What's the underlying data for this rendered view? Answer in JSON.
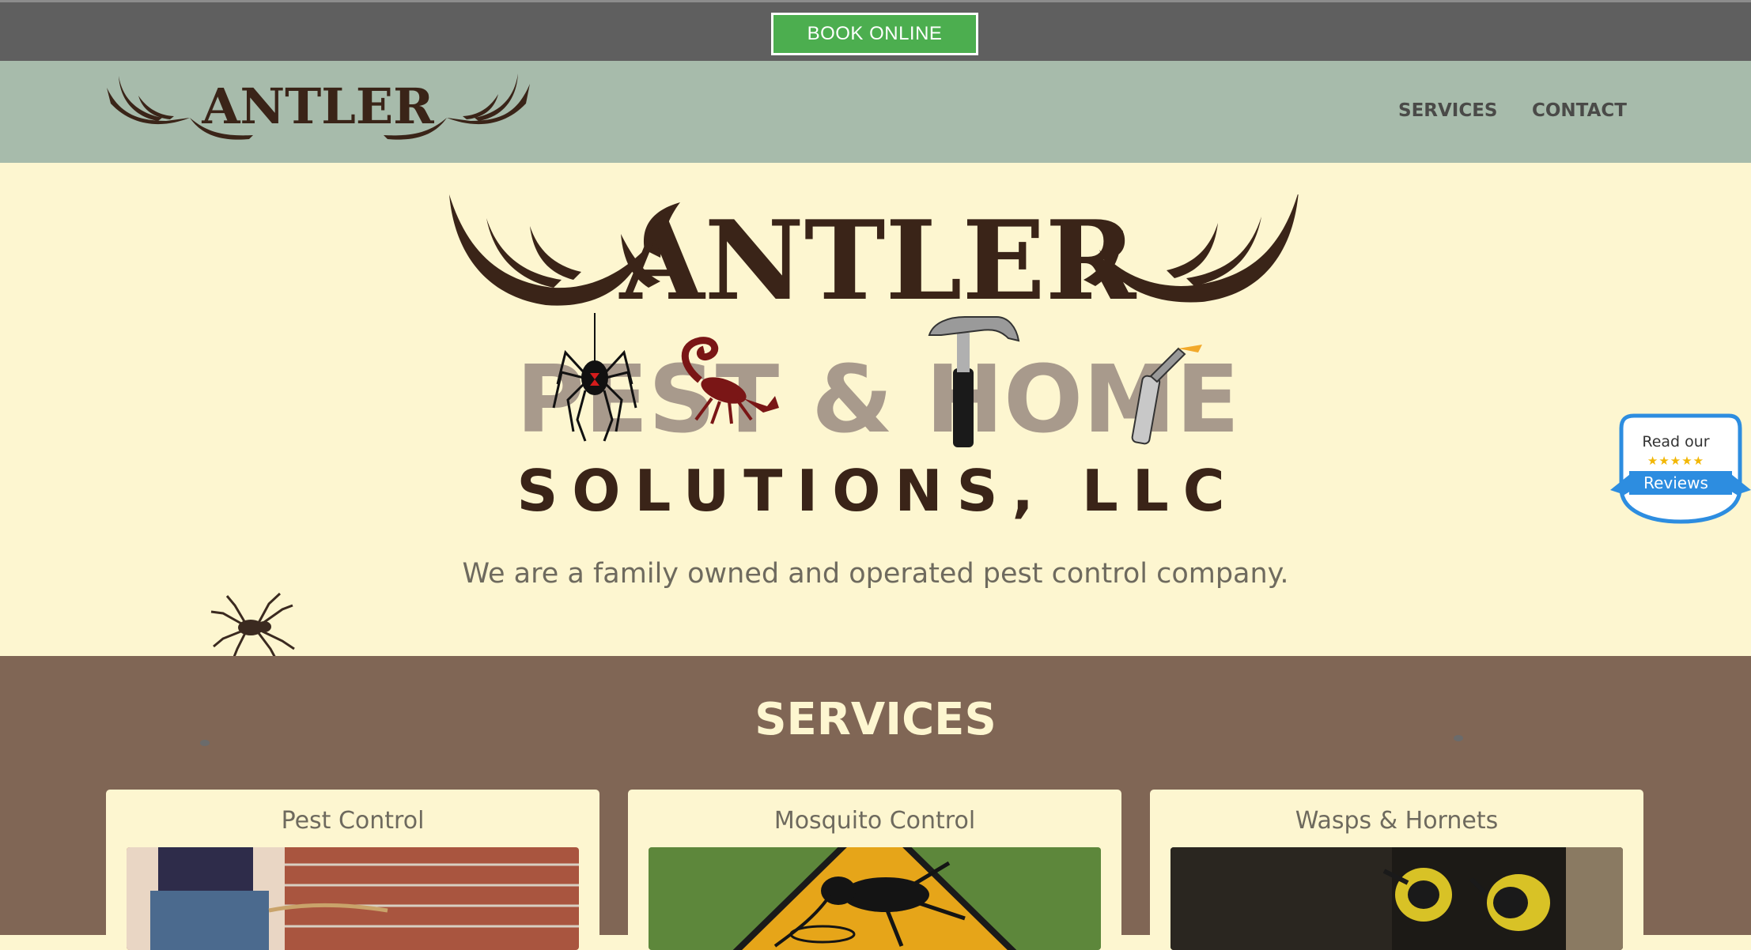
{
  "topbar": {
    "book_label": "BOOK ONLINE"
  },
  "nav": {
    "logo_text": "ANTLER",
    "links": [
      {
        "label": "SERVICES"
      },
      {
        "label": "CONTACT"
      }
    ]
  },
  "hero": {
    "logo_line1": "ANTLER",
    "logo_line2": "PEST & HOME",
    "logo_line3": "SOLUTIONS, LLC",
    "tagline": "We are a family owned and operated pest control company."
  },
  "reviews": {
    "line1": "Read our",
    "stars": "★★★★★",
    "line2": "Reviews"
  },
  "services": {
    "title": "SERVICES",
    "cards": [
      {
        "title": "Pest Control"
      },
      {
        "title": "Mosquito Control"
      },
      {
        "title": "Wasps & Hornets"
      }
    ]
  },
  "colors": {
    "topbar": "#5f5f5f",
    "book_button": "#4cae4f",
    "nav": "#a7bbab",
    "hero": "#fdf6d0",
    "services": "#806655",
    "logo_brown": "#3a2418",
    "logo_gray": "#a89a8c"
  }
}
